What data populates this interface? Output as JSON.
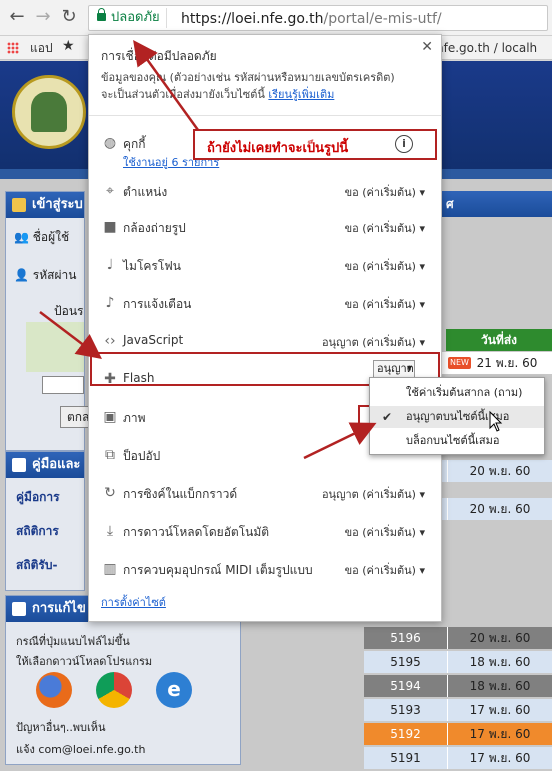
{
  "browser": {
    "back_icon": "back-arrow-icon",
    "forward_icon": "forward-arrow-icon",
    "reload_icon": "reload-icon",
    "secure_label": "ปลอดภัย",
    "url_host": "https://loei.nfe.go.th",
    "url_path": "/portal/e-mis-utf/",
    "bookmarks": {
      "apps_label": "แอป",
      "partial_right": "nfe.go.th / localh"
    }
  },
  "popup": {
    "title": "การเชื่อมต่อมีปลอดภัย",
    "description": "ข้อมูลของคุณ (ตัวอย่างเช่น รหัสผ่านหรือหมายเลขบัตรเครดิต) จะเป็นส่วนตัวเมื่อส่งมายังเว็บไซต์นี้",
    "learn_more": "เรียนรู้เพิ่มเติม",
    "cookie_label": "คุกกี้",
    "cookie_sub": "ใช้งานอยู่ 6 รายการ",
    "permissions": [
      {
        "name": "ตำแหน่ง",
        "value": "ขอ (ค่าเริ่มต้น)",
        "icon": "location-pin-icon"
      },
      {
        "name": "กล้องถ่ายรูป",
        "value": "ขอ (ค่าเริ่มต้น)",
        "icon": "camera-icon"
      },
      {
        "name": "ไมโครโฟน",
        "value": "ขอ (ค่าเริ่มต้น)",
        "icon": "microphone-icon"
      },
      {
        "name": "การแจ้งเตือน",
        "value": "ขอ (ค่าเริ่มต้น)",
        "icon": "bell-icon"
      },
      {
        "name": "JavaScript",
        "value": "อนุญาต (ค่าเริ่มต้น)",
        "icon": "code-icon"
      },
      {
        "name": "Flash",
        "value": "อนุญาต",
        "icon": "puzzle-icon"
      },
      {
        "name": "ภาพ",
        "value": "อนุญาต (",
        "icon": "image-icon"
      },
      {
        "name": "ป็อปอัป",
        "value": "",
        "icon": "popup-icon"
      },
      {
        "name": "การซิงค์ในแบ็กกราวด์",
        "value": "อนุญาต (ค่าเริ่มต้น)",
        "icon": "sync-icon"
      },
      {
        "name": "การดาวน์โหลดโดยอัตโนมัติ",
        "value": "ขอ (ค่าเริ่มต้น)",
        "icon": "download-icon"
      },
      {
        "name": "การควบคุมอุปกรณ์ MIDI เต็มรูปแบบ",
        "value": "ขอ (ค่าเริ่มต้น)",
        "icon": "midi-icon"
      }
    ],
    "site_settings": "การตั้งค่าไซต์",
    "flash_dropdown": {
      "options": [
        "ใช้ค่าเริ่มต้นสากล (ถาม)",
        "อนุญาตบนไซต์นี้เสมอ",
        "บล็อกบนไซต์นี้เสมอ"
      ],
      "selected_index": 1
    }
  },
  "annotation": {
    "callout": "ถ้ายังไม่เคยทำจะเป็นรูปนี้",
    "accent": "#b22222"
  },
  "left_panels": {
    "login_header": "เข้าสู่ระบ",
    "username_label": "ชื่อผู้ใช้",
    "password_label": "รหัสผ่าน",
    "captcha_label": "ป้อนร",
    "login_button": "ตกล",
    "manual_header": "คู่มือและ",
    "manual_items": [
      "คู่มือการ",
      "สถิติการ",
      "สถิติรับ-"
    ],
    "fix_header": "การแก้ไข",
    "fix_text_1": "กรณีที่ปุ่มแนบไฟล์ไม่ขึ้น",
    "fix_text_2": "ให้เลือกดาวน์โหลดโปรแกรม",
    "problem_text": "ปัญหาอื่นๆ..พบเห็น",
    "contact_text": "แจ้ง com@loei.nfe.go.th"
  },
  "right_table": {
    "partial_header": "ศ",
    "date_header": "วันที่ส่ง",
    "new_badge": "NEW",
    "rows": [
      {
        "id": "",
        "date": "21 พ.ย. 60",
        "color": "#ffffff"
      },
      {
        "id": "",
        "date": "20 พ.ย. 60",
        "color": "#d7e3f2"
      },
      {
        "id": "",
        "date": "20 พ.ย. 60",
        "color": "#d7e3f2"
      },
      {
        "id": "5196",
        "date": "20 พ.ย. 60",
        "color": "#808080"
      },
      {
        "id": "5195",
        "date": "18 พ.ย. 60",
        "color": "#d7e3f2"
      },
      {
        "id": "5194",
        "date": "18 พ.ย. 60",
        "color": "#808080"
      },
      {
        "id": "5193",
        "date": "17 พ.ย. 60",
        "color": "#d7e3f2"
      },
      {
        "id": "5192",
        "date": "17 พ.ย. 60",
        "color": "#f08a2c"
      },
      {
        "id": "5191",
        "date": "17 พ.ย. 60",
        "color": "#d7e3f2"
      }
    ]
  }
}
